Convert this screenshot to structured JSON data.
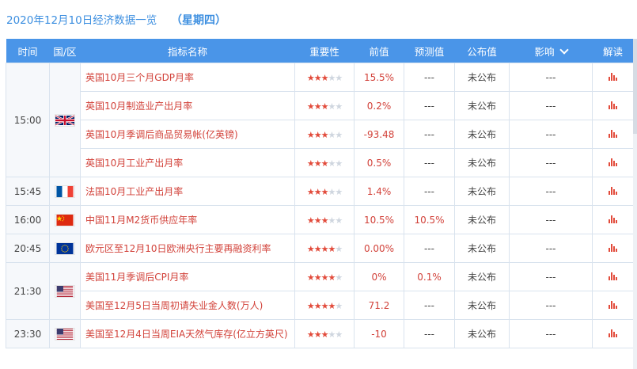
{
  "header": {
    "date_title": "2020年12月10日经济数据一览",
    "weekday": "（星期四）"
  },
  "columns": {
    "time": "时间",
    "country": "国/区",
    "indicator": "指标名称",
    "importance": "重要性",
    "previous": "前值",
    "forecast": "预测值",
    "actual": "公布值",
    "impact": "影响",
    "interpret": "解读"
  },
  "groups": [
    {
      "time": "15:00",
      "flag": "uk-flag-icon",
      "rows": [
        {
          "name": "英国10月三个月GDP月率",
          "stars": 3,
          "prev": "15.5%",
          "forecast": "---",
          "actual": "未公布",
          "impact": "---"
        },
        {
          "name": "英国10月制造业产出月率",
          "stars": 3,
          "prev": "0.2%",
          "forecast": "---",
          "actual": "未公布",
          "impact": "---"
        },
        {
          "name": "英国10月季调后商品贸易帐(亿英镑)",
          "stars": 3,
          "prev": "-93.48",
          "forecast": "---",
          "actual": "未公布",
          "impact": "---"
        },
        {
          "name": "英国10月工业产出月率",
          "stars": 3,
          "prev": "0.5%",
          "forecast": "---",
          "actual": "未公布",
          "impact": "---"
        }
      ]
    },
    {
      "time": "15:45",
      "flag": "france-flag-icon",
      "rows": [
        {
          "name": "法国10月工业产出月率",
          "stars": 3,
          "prev": "1.4%",
          "forecast": "---",
          "actual": "未公布",
          "impact": "---"
        }
      ]
    },
    {
      "time": "16:00",
      "flag": "china-flag-icon",
      "rows": [
        {
          "name": "中国11月M2货币供应年率",
          "stars": 3,
          "prev": "10.5%",
          "forecast": "10.5%",
          "actual": "未公布",
          "impact": "---"
        }
      ]
    },
    {
      "time": "20:45",
      "flag": "eu-flag-icon",
      "rows": [
        {
          "name": "欧元区至12月10日欧洲央行主要再融资利率",
          "stars": 4,
          "prev": "0.00%",
          "forecast": "---",
          "actual": "未公布",
          "impact": "---"
        }
      ]
    },
    {
      "time": "21:30",
      "flag": "us-flag-icon",
      "rows": [
        {
          "name": "美国11月季调后CPI月率",
          "stars": 4,
          "prev": "0%",
          "forecast": "0.1%",
          "actual": "未公布",
          "impact": "---"
        },
        {
          "name": "美国至12月5日当周初请失业金人数(万人)",
          "stars": 4,
          "prev": "71.2",
          "forecast": "---",
          "actual": "未公布",
          "impact": "---"
        }
      ]
    },
    {
      "time": "23:30",
      "flag": "us-flag-icon",
      "rows": [
        {
          "name": "美国至12月4日当周EIA天然气库存(亿立方英尺)",
          "stars": 3,
          "prev": "-10",
          "forecast": "---",
          "actual": "未公布",
          "impact": "---"
        }
      ]
    }
  ],
  "colors": {
    "accent": "#4a95e8",
    "title": "#3d8fe0",
    "highlight": "#d2423a"
  }
}
